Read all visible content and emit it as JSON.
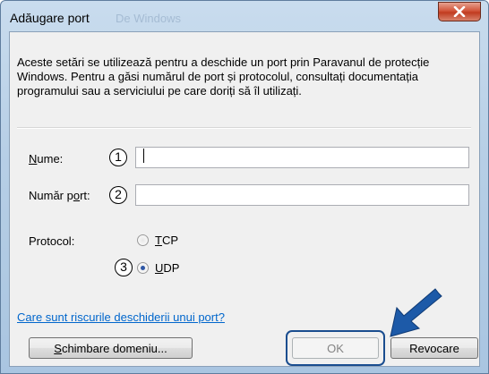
{
  "window": {
    "title": "Adăugare port",
    "ghost_title": "De Windows"
  },
  "description": "Aceste setări se utilizează pentru a deschide un port prin Paravanul de protecție Windows. Pentru a găsi numărul de port și protocolul, consultați documentația programului sau a serviciului pe care doriți să îl utilizați.",
  "form": {
    "name_label_accel": "N",
    "name_label_rest": "ume:",
    "name_value": "",
    "port_label_pre": "Număr p",
    "port_label_accel": "o",
    "port_label_post": "rt:",
    "port_value": "",
    "protocol_label": "Protocol:",
    "tcp_accel": "T",
    "tcp_rest": "CP",
    "udp_accel": "U",
    "udp_rest": "DP",
    "selected_protocol": "UDP"
  },
  "callouts": {
    "one": "1",
    "two": "2",
    "three": "3"
  },
  "link_text": "Care sunt riscurile deschiderii unui port?",
  "buttons": {
    "change_scope_accel": "S",
    "change_scope_rest": "chimbare domeniu...",
    "ok": "OK",
    "cancel": "Revocare"
  },
  "colors": {
    "highlight": "#1a4d8f",
    "arrow": "#1d5aa8",
    "link": "#0066cc"
  },
  "icons": {
    "close": "close-x-icon",
    "arrow": "pointer-arrow-icon"
  }
}
